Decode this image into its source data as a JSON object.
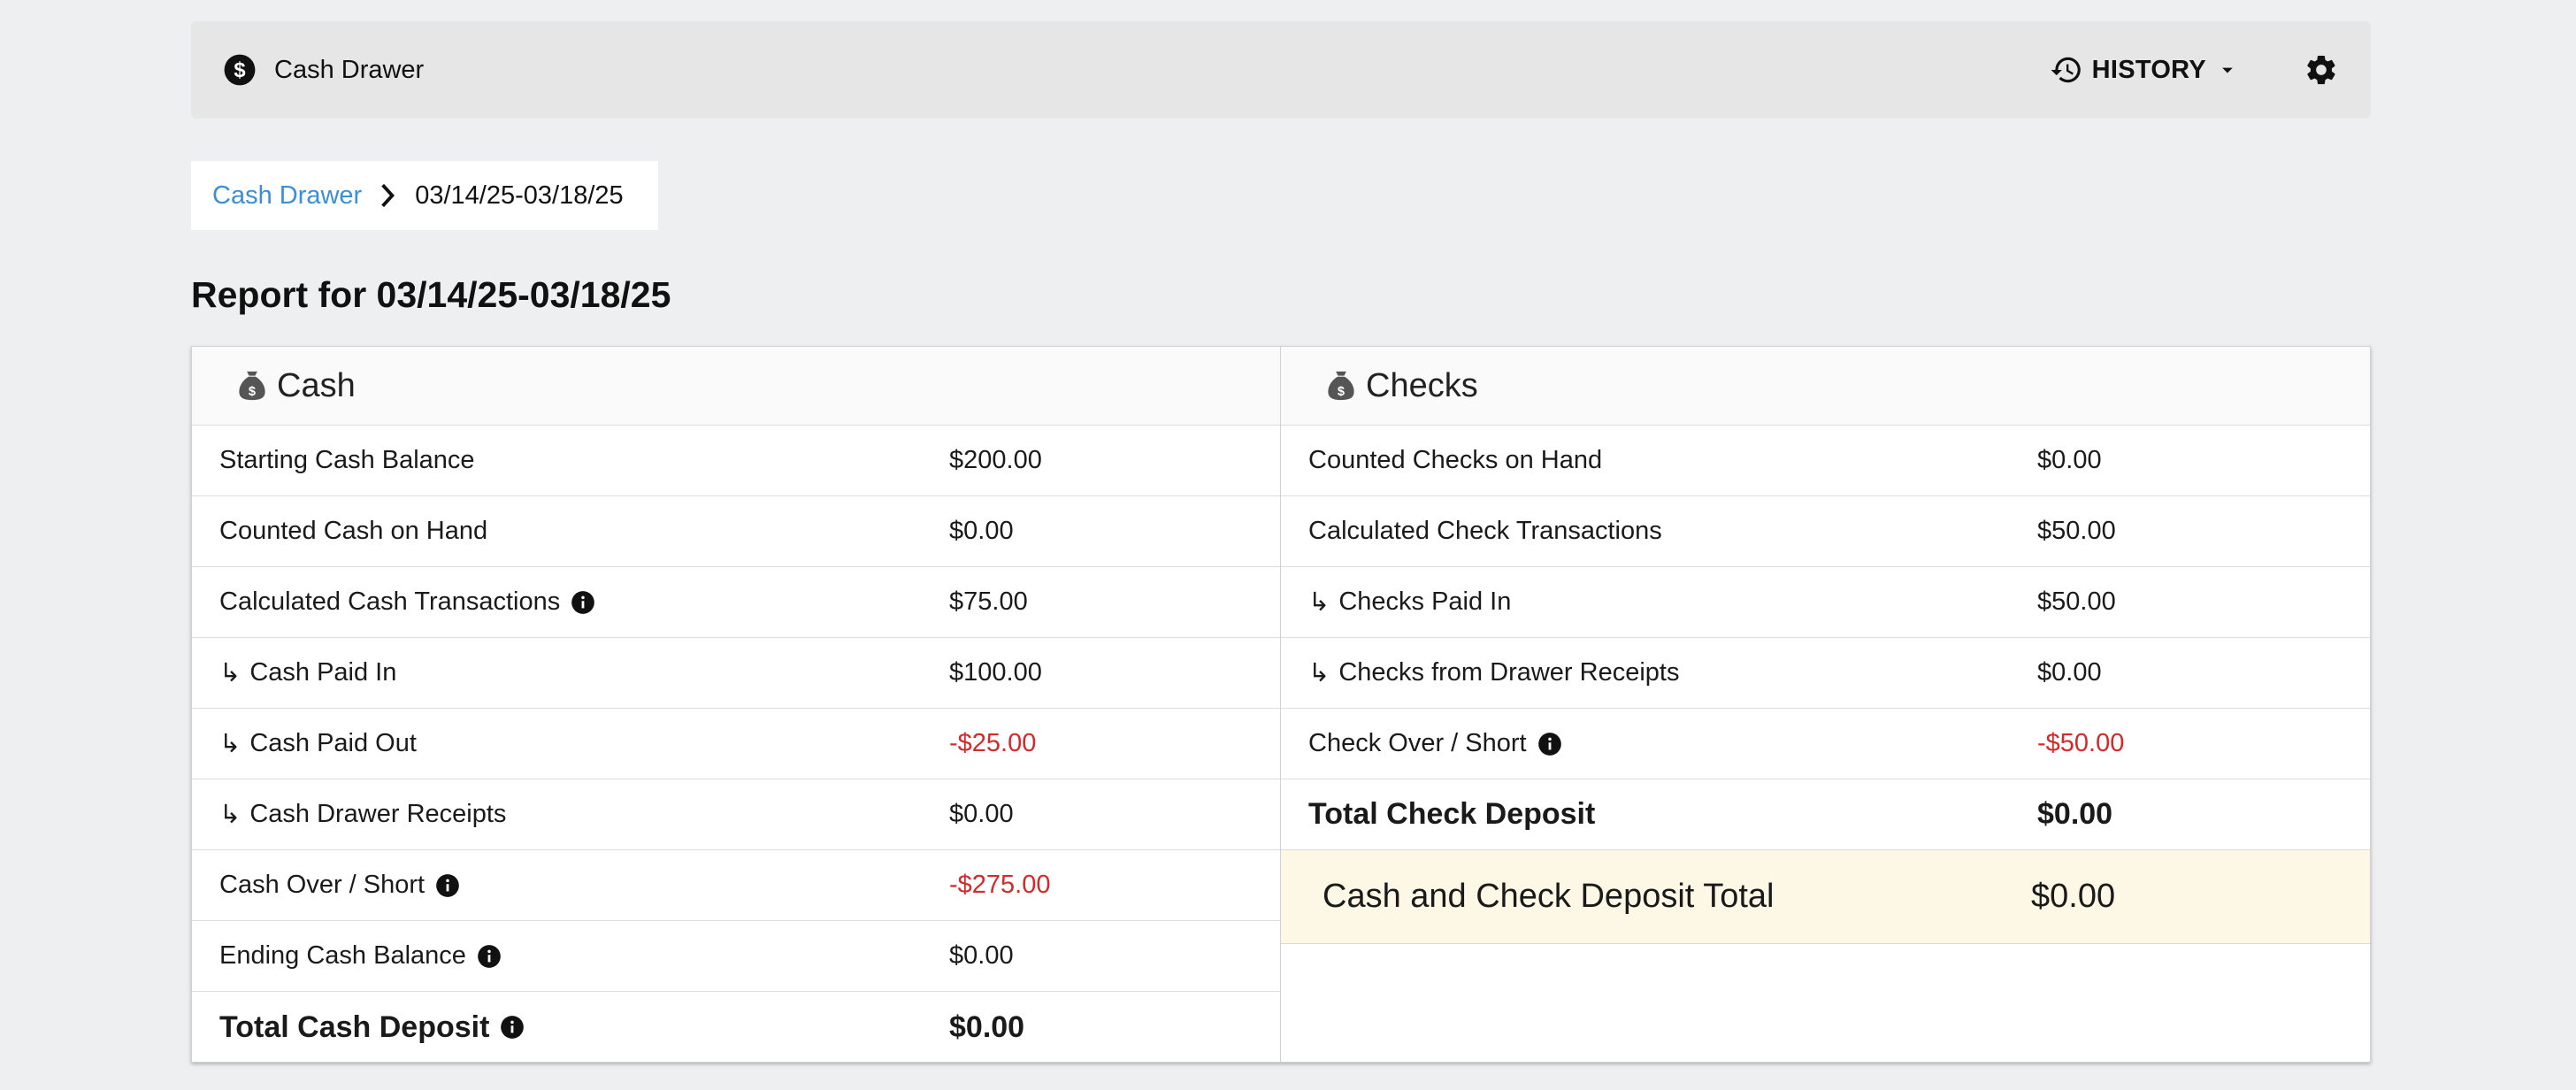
{
  "header": {
    "app_icon": "dollar-circle-icon",
    "title": "Cash Drawer",
    "history_label": "HISTORY",
    "settings_icon": "gear-icon"
  },
  "breadcrumb": {
    "root": "Cash Drawer",
    "current": "03/14/25-03/18/25"
  },
  "report": {
    "title": "Report for 03/14/25-03/18/25"
  },
  "cash": {
    "heading": "Cash",
    "rows": [
      {
        "label": "Starting Cash Balance",
        "value": "$200.00"
      },
      {
        "label": "Counted Cash on Hand",
        "value": "$0.00"
      },
      {
        "label": "Calculated Cash Transactions",
        "value": "$75.00"
      },
      {
        "label": "Cash Paid In",
        "value": "$100.00"
      },
      {
        "label": "Cash Paid Out",
        "value": "-$25.00"
      },
      {
        "label": "Cash Drawer Receipts",
        "value": "$0.00"
      },
      {
        "label": "Cash Over / Short",
        "value": "-$275.00"
      },
      {
        "label": "Ending Cash Balance",
        "value": "$0.00"
      },
      {
        "label": "Total Cash Deposit",
        "value": "$0.00"
      }
    ]
  },
  "checks": {
    "heading": "Checks",
    "rows": [
      {
        "label": "Counted Checks on Hand",
        "value": "$0.00"
      },
      {
        "label": "Calculated Check Transactions",
        "value": "$50.00"
      },
      {
        "label": "Checks Paid In",
        "value": "$50.00"
      },
      {
        "label": "Checks from Drawer Receipts",
        "value": "$0.00"
      },
      {
        "label": "Check Over / Short",
        "value": "-$50.00"
      },
      {
        "label": "Total Check Deposit",
        "value": "$0.00"
      }
    ],
    "grand_total_label": "Cash and Check Deposit Total",
    "grand_total_value": "$0.00"
  },
  "symbols": {
    "sub_arrow": "↳"
  },
  "colors": {
    "link": "#3a8fd8",
    "negative": "#d62a2a",
    "grand_total_bg": "#fdf7e6"
  }
}
